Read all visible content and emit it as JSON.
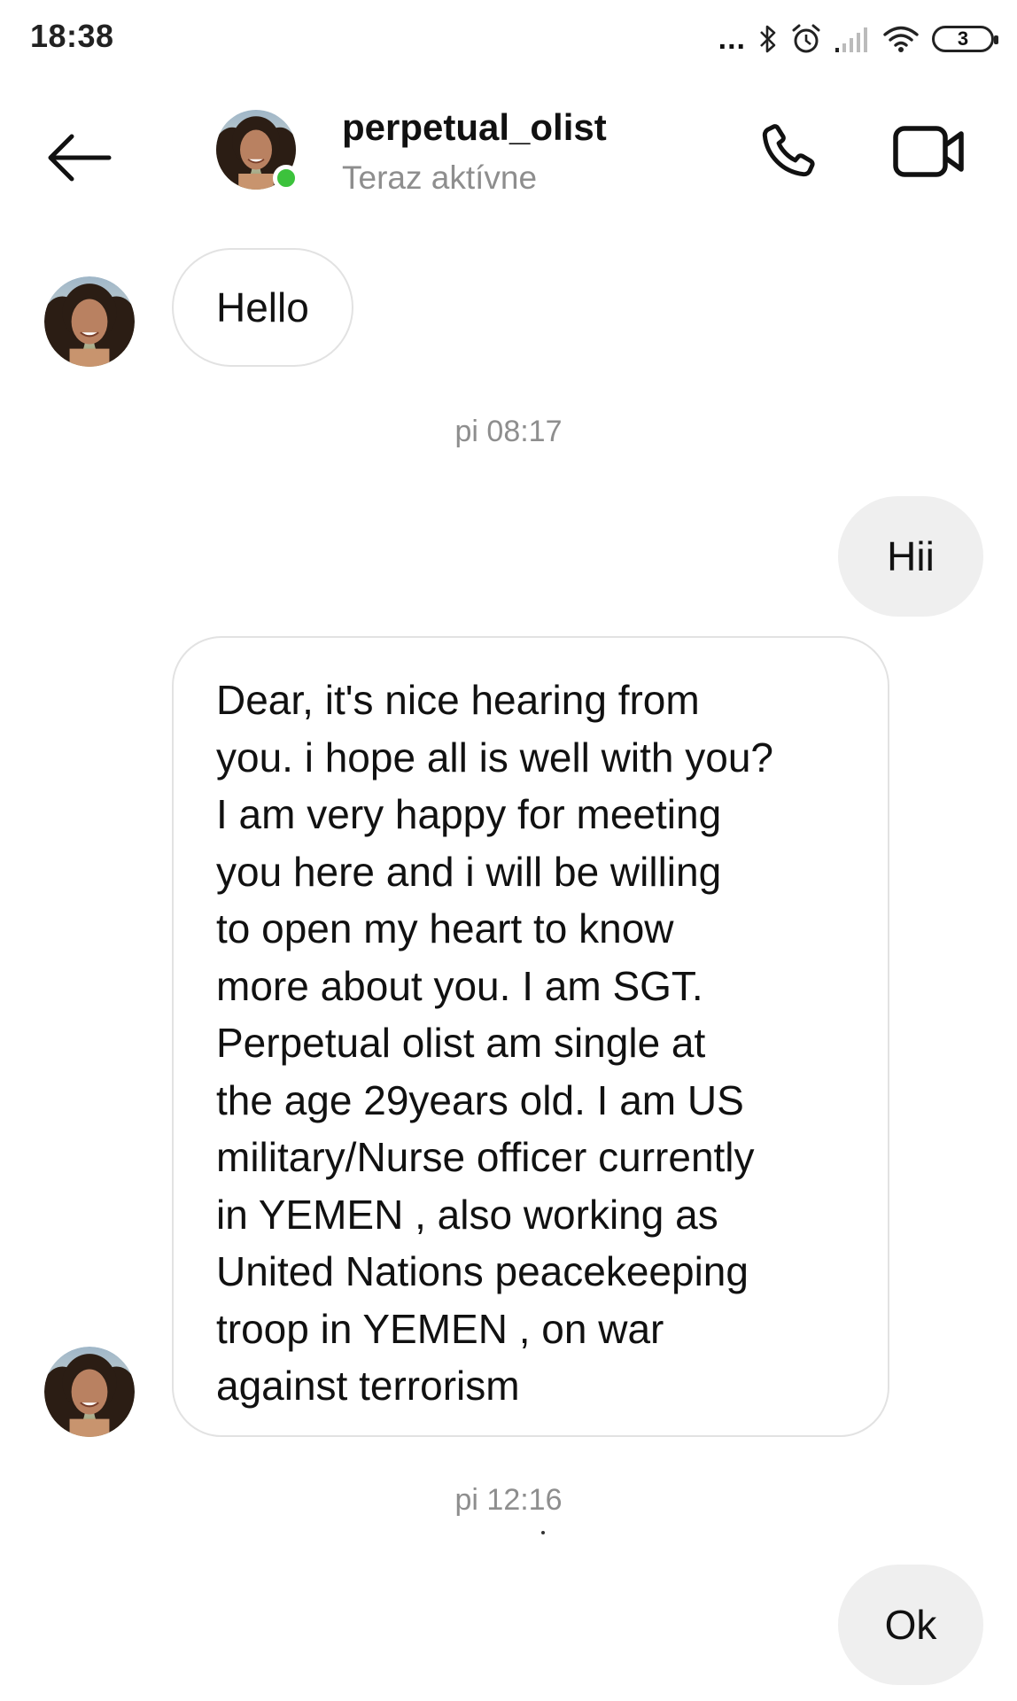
{
  "status_bar": {
    "time": "18:38",
    "more_indicator": "...",
    "battery_level": "3",
    "icons": [
      "bluetooth-icon",
      "alarm-icon",
      "signal-icon",
      "wifi-icon",
      "battery-icon"
    ]
  },
  "header": {
    "username": "perpetual_olist",
    "status": "Teraz aktívne",
    "icons": [
      "back-arrow-icon",
      "phone-icon",
      "video-camera-icon"
    ]
  },
  "messages": [
    {
      "direction": "incoming",
      "text": "Hello"
    },
    {
      "direction": "divider",
      "text": "pi 08:17"
    },
    {
      "direction": "outgoing",
      "text": "Hii"
    },
    {
      "direction": "incoming",
      "lines": [
        "Dear, it's nice hearing from",
        "you. i hope all is well with you?",
        "I am very happy for meeting",
        "you here and i will be willing",
        "to open my heart to know",
        "more about you. I am SGT.",
        "Perpetual olist am single at",
        "the age 29years old. I am US",
        "military/Nurse officer currently",
        "in YEMEN , also working as",
        "United Nations peacekeeping",
        "troop in YEMEN , on war",
        "against terrorism"
      ]
    },
    {
      "direction": "divider",
      "text": "pi 12:16"
    },
    {
      "direction": "outgoing",
      "text": "Ok"
    }
  ],
  "colors": {
    "online": "#3cc23c",
    "incoming_border": "#e2e2e2",
    "outgoing_bg": "#efefef",
    "muted_text": "#8e8e8e"
  }
}
